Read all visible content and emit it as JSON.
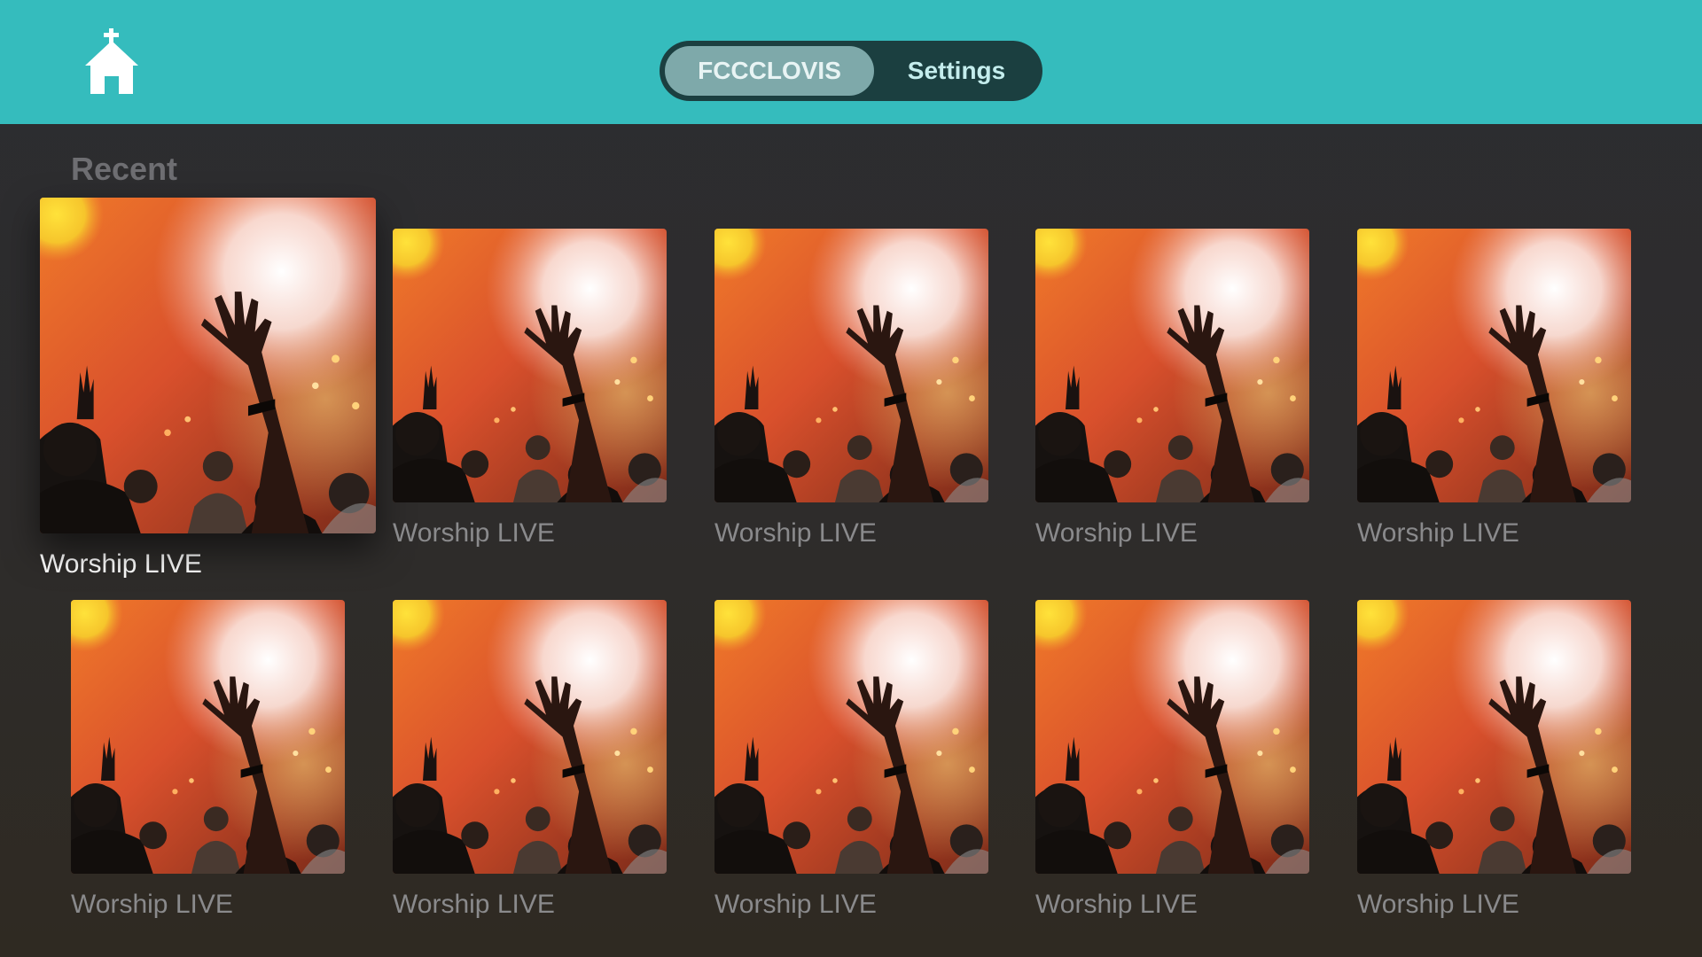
{
  "header": {
    "home_icon": "church-home-icon",
    "tabs": [
      {
        "label": "FCCCLOVIS",
        "active": true
      },
      {
        "label": "Settings",
        "active": false
      }
    ],
    "colors": {
      "bar": "#35bcbd",
      "tabbar": "#1b3f40",
      "active_tab": "#7ea9aa"
    }
  },
  "main": {
    "section_title": "Recent",
    "focused_index": 0,
    "items": [
      {
        "title": "Worship LIVE"
      },
      {
        "title": "Worship LIVE"
      },
      {
        "title": "Worship LIVE"
      },
      {
        "title": "Worship LIVE"
      },
      {
        "title": "Worship LIVE"
      },
      {
        "title": "Worship LIVE"
      },
      {
        "title": "Worship LIVE"
      },
      {
        "title": "Worship LIVE"
      },
      {
        "title": "Worship LIVE"
      },
      {
        "title": "Worship LIVE"
      }
    ]
  }
}
